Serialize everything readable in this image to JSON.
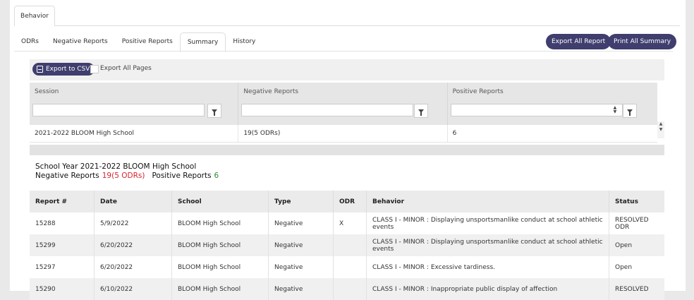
{
  "outer_tab": "Behavior",
  "subtabs": [
    "ODRs",
    "Negative Reports",
    "Positive Reports",
    "Summary",
    "History"
  ],
  "buttons": {
    "export_all": "Export All Report",
    "print_all": "Print All Summary",
    "export_csv": "Export to CSV",
    "export_all_pages": "Export All Pages"
  },
  "grid": {
    "headers": [
      "Session",
      "Negative Reports",
      "Positive Reports"
    ],
    "row": [
      "2021-2022 BLOOM High School",
      "19(5 ODRs)",
      "6"
    ]
  },
  "summary": {
    "title": "School Year 2021-2022 BLOOM High School",
    "neg_label": "Negative Reports",
    "neg_value": "19(5 ODRs)",
    "pos_label": "Positive Reports",
    "pos_value": "6"
  },
  "reports": {
    "headers": [
      "Report #",
      "Date",
      "School",
      "Type",
      "ODR",
      "Behavior",
      "Status"
    ],
    "rows": [
      [
        "15288",
        "5/9/2022",
        "BLOOM High School",
        "Negative",
        "X",
        "CLASS I - MINOR : Displaying unsportsmanlike conduct at school athletic events",
        "RESOLVED ODR"
      ],
      [
        "15299",
        "6/20/2022",
        "BLOOM High School",
        "Negative",
        "",
        "CLASS I - MINOR : Displaying unsportsmanlike conduct at school athletic events",
        "Open"
      ],
      [
        "15297",
        "6/20/2022",
        "BLOOM High School",
        "Negative",
        "",
        "CLASS I - MINOR : Excessive tardiness.",
        "Open"
      ],
      [
        "15290",
        "6/10/2022",
        "BLOOM High School",
        "Negative",
        "",
        "CLASS I - MINOR : Inappropriate public display of affection",
        "RESOLVED"
      ]
    ]
  },
  "colors": {
    "accent": "#3f3e6e",
    "negative": "#d9232e",
    "positive": "#2e8b2e",
    "link": "#2a4db0"
  }
}
